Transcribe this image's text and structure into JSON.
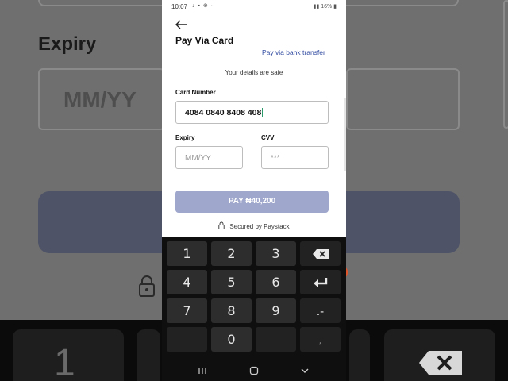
{
  "status_bar": {
    "time": "10:07",
    "battery": "16%"
  },
  "header": {
    "title": "Pay Via Card",
    "bank_transfer_link": "Pay via bank transfer",
    "safe_note": "Your details are safe"
  },
  "form": {
    "card_number_label": "Card Number",
    "card_number_value": "4084 0840 8408 408",
    "expiry_label": "Expiry",
    "expiry_placeholder": "MM/YY",
    "cvv_label": "CVV",
    "cvv_placeholder": "***"
  },
  "pay_button": {
    "label": "PAY ₦40,200"
  },
  "secured_text": "Secured by Paystack",
  "keyboard": {
    "rows": [
      [
        "1",
        "2",
        "3",
        "backspace"
      ],
      [
        "4",
        "5",
        "6",
        "enter"
      ],
      [
        "7",
        "8",
        "9",
        ".-"
      ],
      [
        "",
        "0",
        "",
        ","
      ]
    ]
  },
  "background": {
    "expiry_label": "Expiry",
    "expiry_placeholder": "MM/YY",
    "key_1": "1"
  },
  "colors": {
    "pay_button": "#9fa7cc",
    "link": "#2f4aa0",
    "keyboard_bg": "#0f0f0f",
    "key_bg": "#2d2d2d"
  }
}
